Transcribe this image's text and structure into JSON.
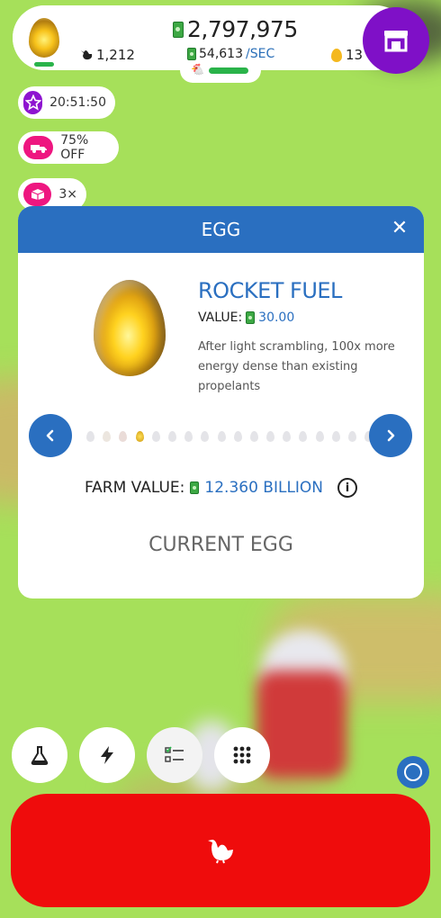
{
  "header": {
    "money": "2,797,975",
    "chicken_count": "1,212",
    "rate_value": "54,613",
    "rate_unit": "/SEC",
    "golden_eggs": "13",
    "shop_icon": "shop-icon"
  },
  "boosts": [
    {
      "icon": "star-icon",
      "text": "20:51:50",
      "color": "#8e14d0"
    },
    {
      "icon": "truck-icon",
      "text": "75% OFF",
      "color": "#ee1680"
    },
    {
      "icon": "box-icon",
      "text": "3×",
      "color": "#ee1680"
    }
  ],
  "dialog": {
    "title": "EGG",
    "close_icon": "close-icon",
    "egg_name": "ROCKET FUEL",
    "value_label": "VALUE:",
    "value": "30.00",
    "description": "After light scrambling, 100x more energy dense than existing propelants",
    "farm_value_label": "FARM VALUE:",
    "farm_value": "12.360 BILLION",
    "status": "CURRENT EGG",
    "egg_count": 20,
    "current_index": 3
  },
  "bottom_bar": {
    "buttons": [
      "research-flask-icon",
      "boost-lightning-icon",
      "checklist-icon",
      "grid-menu-icon"
    ],
    "hatch_icon": "chicken-icon"
  },
  "colors": {
    "accent_blue": "#2a6fc0",
    "purple": "#7f10c7",
    "pink": "#ee1680",
    "hatch_red": "#ef0c0c",
    "green": "#2ab34a"
  }
}
